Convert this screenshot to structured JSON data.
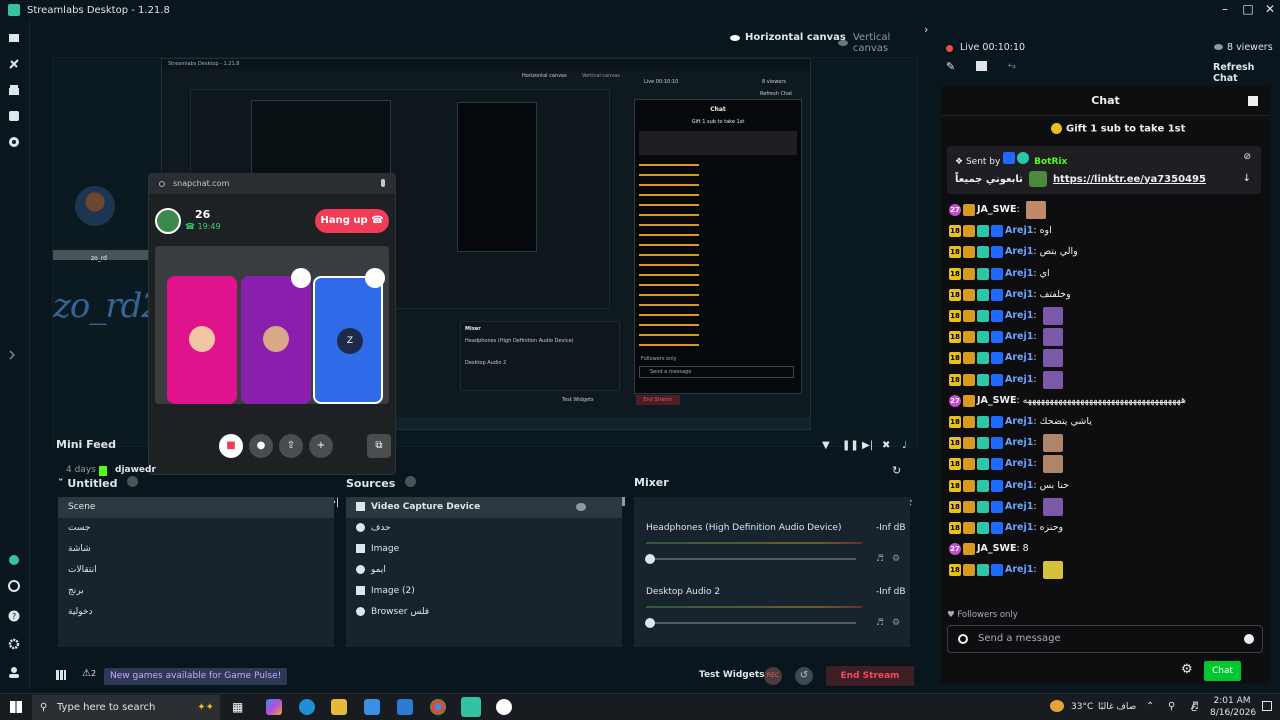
{
  "app": {
    "title": "Streamlabs Desktop - 1.21.8"
  },
  "editor": {
    "canvas": {
      "horizontal": "Horizontal canvas",
      "vertical": "Vertical canvas"
    },
    "preview": {
      "streamer_name": "zo_rd20",
      "cam_caption": "zo_rd"
    },
    "snapchat": {
      "url": "snapchat.com",
      "participants": "26",
      "call_time": "19:49",
      "hangup": "Hang up",
      "tile_label": "Z"
    },
    "nested": {
      "title": "Streamlabs Desktop - 1.21.8",
      "canvas_h": "Horizontal canvas",
      "canvas_v": "Vertical canvas",
      "live": "Live 00:10:10",
      "viewers": "8 viewers",
      "refresh": "Refresh Chat",
      "chat": "Chat",
      "gift": "Gift 1 sub to take 1st",
      "mixer": "Mixer",
      "mix1": "Headphones (High Definition Audio Device)",
      "mix2": "Desktop Audio 2",
      "followers": "Followers only",
      "send": "Send a message",
      "test": "Test Widgets",
      "end": "End Stream"
    }
  },
  "minifeed": {
    "title": "Mini Feed",
    "age": "4 days",
    "user": "djawedr"
  },
  "scenes": {
    "collection": "Untitled",
    "items": [
      "Scene",
      "جست",
      "شاشة",
      "انتقالات",
      "برنج",
      "دخولية"
    ]
  },
  "sources": {
    "title": "Sources",
    "items": [
      "Video Capture Device",
      "حدف",
      "Image",
      "ايمو",
      "Image (2)",
      "Browser فلس"
    ]
  },
  "mixer": {
    "title": "Mixer",
    "channels": [
      {
        "name": "Headphones (High Definition Audio Device)",
        "db": "-Inf dB",
        "level": 0
      },
      {
        "name": "Desktop Audio 2",
        "db": "-Inf dB",
        "level": 0
      }
    ]
  },
  "footer": {
    "badge_count": "2",
    "game_pulse": "New games available for Game Pulse!",
    "test_widgets": "Test Widgets",
    "rec": "REC",
    "end_stream": "End Stream"
  },
  "live": {
    "status": "Live 00:10:10",
    "viewers": "8 viewers",
    "refresh": "Refresh Chat"
  },
  "chat": {
    "title": "Chat",
    "gift": "Gift 1 sub to take 1st",
    "pinned": {
      "sent_by_label": "Sent by",
      "sender": "BotRix",
      "text": "تابعوني جميعاً",
      "link": "https://linktr.ee/ya7350495"
    },
    "messages": [
      {
        "user": "JA_SWE",
        "badge": "27",
        "text": "",
        "emote": "#c08a6a"
      },
      {
        "user": "Arej1",
        "badge": "18",
        "text": "اوه",
        "emote": ""
      },
      {
        "user": "Arej1",
        "badge": "18",
        "text": "والي بتص",
        "emote": ""
      },
      {
        "user": "Arej1",
        "badge": "18",
        "text": "اي",
        "emote": ""
      },
      {
        "user": "Arej1",
        "badge": "18",
        "text": "وخلفتف",
        "emote": ""
      },
      {
        "user": "Arej1",
        "badge": "18",
        "text": "",
        "emote": "#7a5aa8"
      },
      {
        "user": "Arej1",
        "badge": "18",
        "text": "",
        "emote": "#7a5aa8"
      },
      {
        "user": "Arej1",
        "badge": "18",
        "text": "",
        "emote": "#7a5aa8"
      },
      {
        "user": "Arej1",
        "badge": "18",
        "text": "",
        "emote": "#7a5aa8"
      },
      {
        "user": "JA_SWE",
        "badge": "27",
        "text": "ههههههههههههههههههههههههههههههههههههه",
        "emote": ""
      },
      {
        "user": "Arej1",
        "badge": "18",
        "text": "ياشي يتضحك",
        "emote": ""
      },
      {
        "user": "Arej1",
        "badge": "18",
        "text": "",
        "emote": "#b0866a"
      },
      {
        "user": "Arej1",
        "badge": "18",
        "text": "",
        "emote": "#b0866a"
      },
      {
        "user": "Arej1",
        "badge": "18",
        "text": "حنا بس",
        "emote": ""
      },
      {
        "user": "Arej1",
        "badge": "18",
        "text": "",
        "emote": "#7a5aa8"
      },
      {
        "user": "Arej1",
        "badge": "18",
        "text": "وحنزه",
        "emote": ""
      },
      {
        "user": "JA_SWE",
        "badge": "27",
        "text": "8",
        "emote": ""
      },
      {
        "user": "Arej1",
        "badge": "18",
        "text": "",
        "emote": "#d6c23a"
      }
    ],
    "followers_only": "Followers only",
    "placeholder": "Send a message",
    "send": "Chat"
  },
  "taskbar": {
    "search": "Type here to search",
    "weather": "33°C",
    "weather_text": "صاف غالبًا",
    "lang": "ع",
    "time": "2:01 AM",
    "date": "8/16/2026"
  },
  "colors": {
    "accent": "#31c3a2",
    "live": "#f04a4a",
    "chat_send": "#00c62f",
    "end_stream": "#f04a60",
    "hangup": "#f23c57"
  }
}
